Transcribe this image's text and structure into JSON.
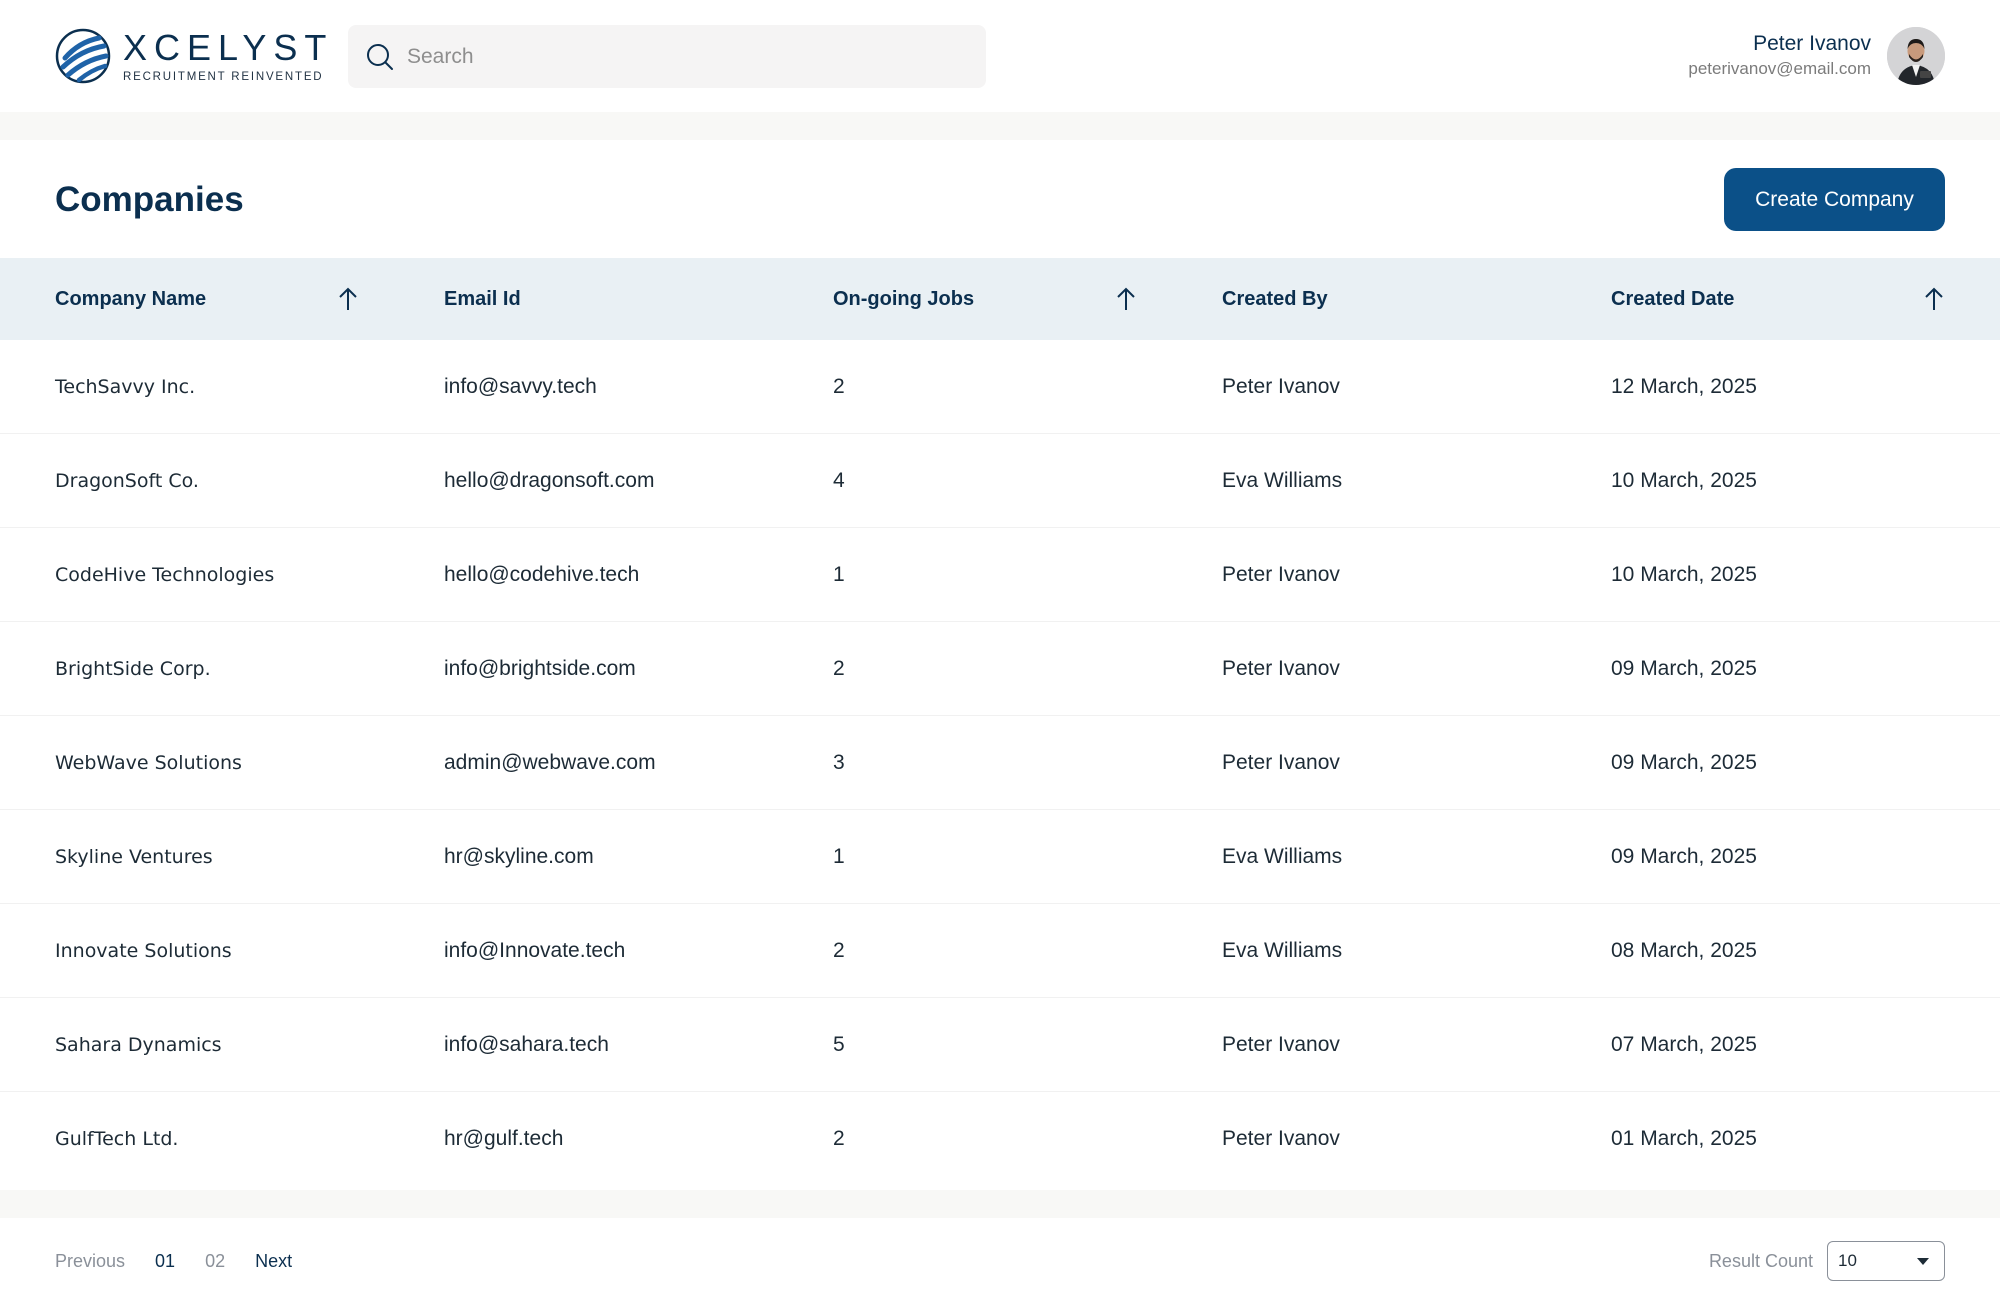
{
  "brand": {
    "name": "XCELYST",
    "tagline": "RECRUITMENT REINVENTED"
  },
  "search": {
    "placeholder": "Search",
    "icon": "search-icon"
  },
  "user": {
    "name": "Peter Ivanov",
    "email": "peterivanov@email.com"
  },
  "page": {
    "title": "Companies",
    "create_button_label": "Create Company"
  },
  "table": {
    "columns": [
      {
        "label": "Company Name",
        "sortable": true
      },
      {
        "label": "Email Id",
        "sortable": false
      },
      {
        "label": "On-going Jobs",
        "sortable": true
      },
      {
        "label": "Created By",
        "sortable": false
      },
      {
        "label": "Created Date",
        "sortable": true
      }
    ],
    "rows": [
      [
        "TechSavvy Inc.",
        "info@savvy.tech",
        "2",
        "Peter Ivanov",
        "12 March, 2025"
      ],
      [
        "DragonSoft Co.",
        "hello@dragonsoft.com",
        "4",
        "Eva Williams",
        "10 March, 2025"
      ],
      [
        "CodeHive Technologies",
        "hello@codehive.tech",
        "1",
        "Peter Ivanov",
        "10 March, 2025"
      ],
      [
        "BrightSide Corp.",
        "info@brightside.com",
        "2",
        "Peter Ivanov",
        "09 March, 2025"
      ],
      [
        "WebWave Solutions",
        "admin@webwave.com",
        "3",
        "Peter Ivanov",
        "09 March, 2025"
      ],
      [
        "Skyline Ventures",
        "hr@skyline.com",
        "1",
        "Eva Williams",
        "09 March, 2025"
      ],
      [
        "Innovate Solutions",
        "info@Innovate.tech",
        "2",
        "Eva Williams",
        "08 March, 2025"
      ],
      [
        "Sahara Dynamics",
        "info@sahara.tech",
        "5",
        "Peter Ivanov",
        "07 March, 2025"
      ],
      [
        "GulfTech Ltd.",
        "hr@gulf.tech",
        "2",
        "Peter Ivanov",
        "01 March, 2025"
      ]
    ]
  },
  "pagination": {
    "previous": "Previous",
    "pages": [
      "01",
      "02"
    ],
    "current_page": "01",
    "next": "Next",
    "result_count_label": "Result Count",
    "result_count_value": "10"
  },
  "colors": {
    "primary": "#0b5088",
    "text_dark": "#0b2f4f",
    "header_bg": "#e9f0f4",
    "page_bg": "#f8f8f6"
  }
}
